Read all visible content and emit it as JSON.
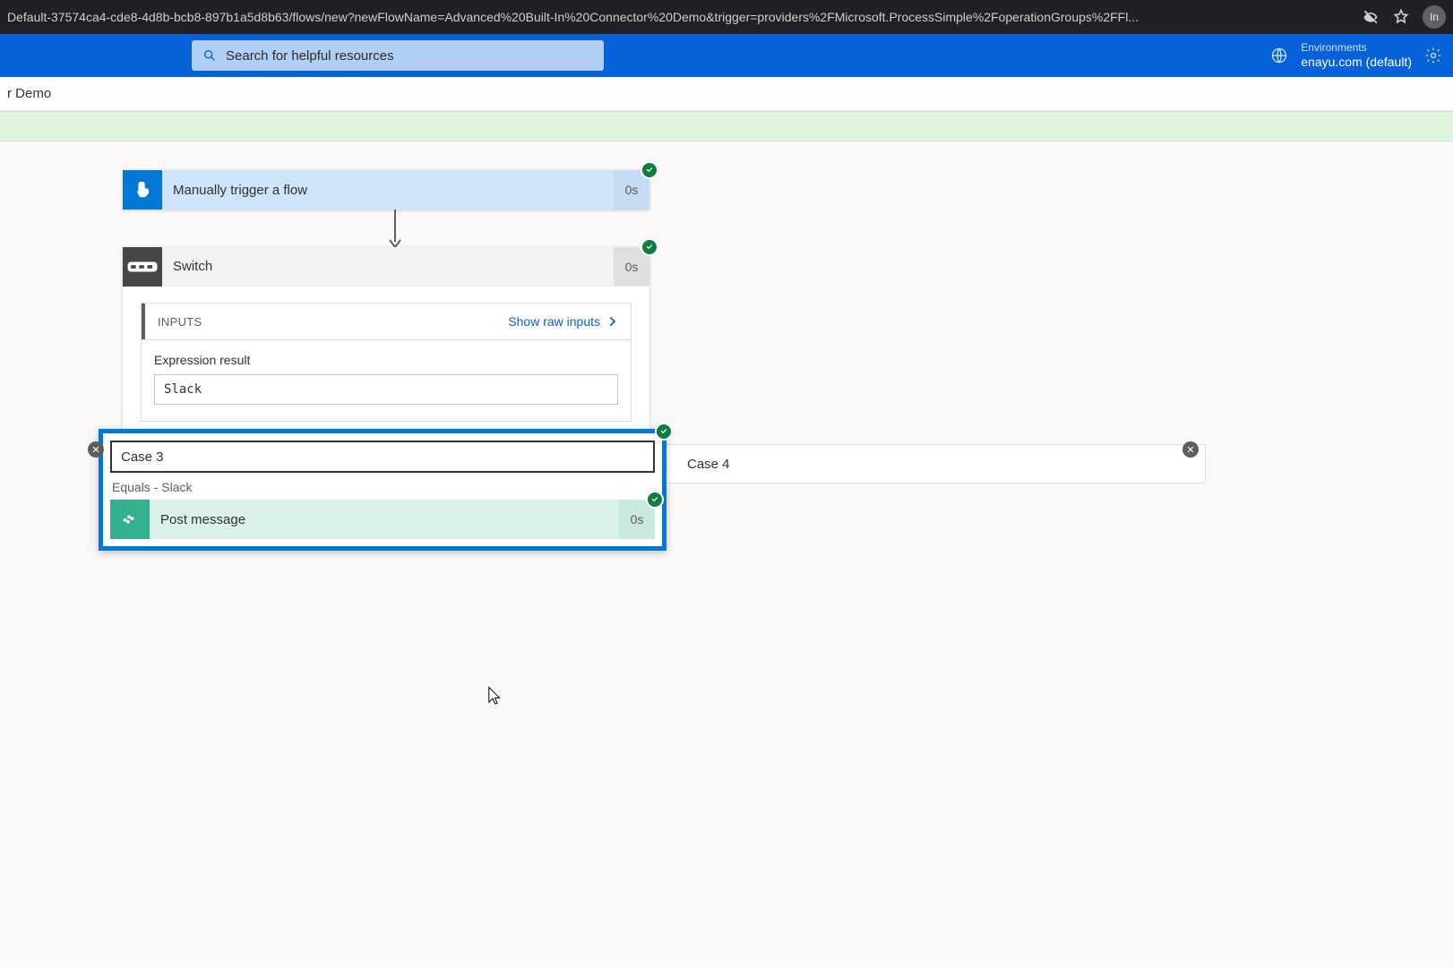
{
  "browser": {
    "url": "Default-37574ca4-cde8-4d8b-bcb8-897b1a5d8b63/flows/new?newFlowName=Advanced%20Built-In%20Connector%20Demo&trigger=providers%2FMicrosoft.ProcessSimple%2FoperationGroups%2FFl...",
    "profile_initial": "In"
  },
  "topbar": {
    "search_placeholder": "Search for helpful resources",
    "env_label": "Environments",
    "env_name": "enayu.com (default)"
  },
  "breadcrumb": {
    "title_fragment": "r Demo"
  },
  "trigger": {
    "title": "Manually trigger a flow",
    "duration": "0s"
  },
  "switch": {
    "title": "Switch",
    "duration": "0s",
    "inputs_label": "INPUTS",
    "raw_link": "Show raw inputs",
    "expr_label": "Expression result",
    "expr_value": "Slack"
  },
  "cases": {
    "case3_title": "Case 3",
    "case3_subtitle": "Equals - Slack",
    "post_label": "Post message",
    "post_duration": "0s",
    "case4_title": "Case 4"
  }
}
